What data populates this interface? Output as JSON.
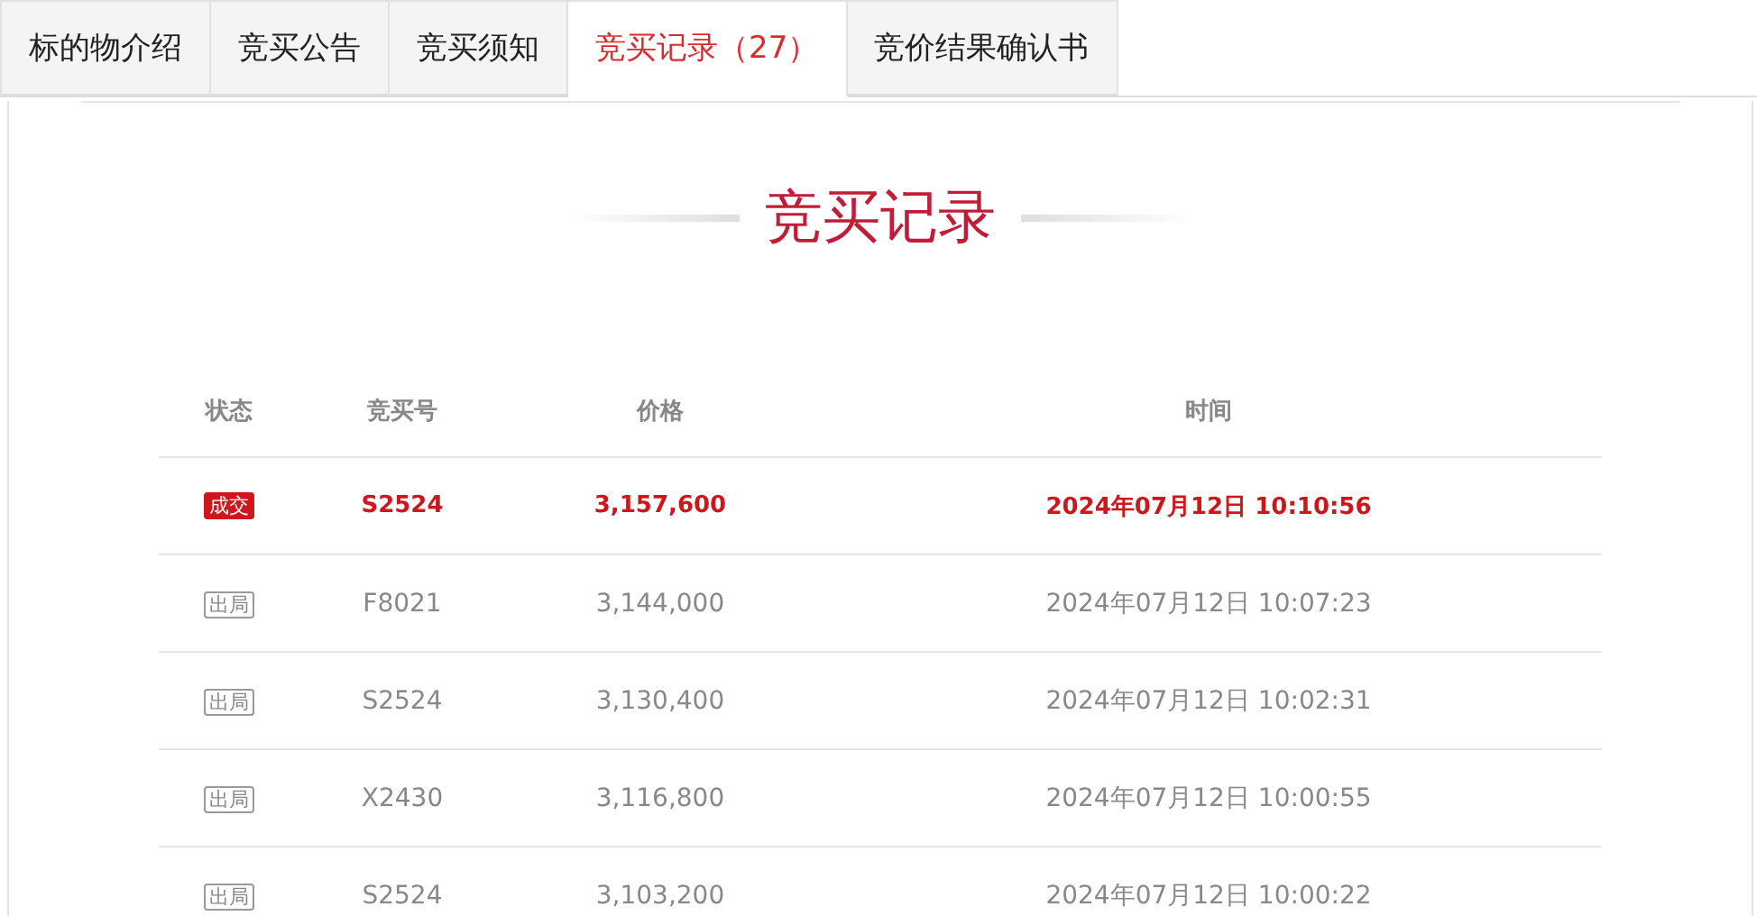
{
  "tabs": [
    {
      "label": "标的物介绍",
      "selected": false
    },
    {
      "label": "竞买公告",
      "selected": false
    },
    {
      "label": "竞买须知",
      "selected": false
    },
    {
      "label": "竞买记录（27）",
      "selected": true
    },
    {
      "label": "竞价结果确认书",
      "selected": false
    }
  ],
  "title": "竞买记录",
  "table": {
    "columns": [
      "状态",
      "竞买号",
      "价格",
      "时间"
    ],
    "rows": [
      {
        "kind": "won",
        "status": "成交",
        "bidder": "S2524",
        "price": "3,157,600",
        "time": "2024年07月12日 10:10:56"
      },
      {
        "kind": "out",
        "status": "出局",
        "bidder": "F8021",
        "price": "3,144,000",
        "time": "2024年07月12日 10:07:23"
      },
      {
        "kind": "out",
        "status": "出局",
        "bidder": "S2524",
        "price": "3,130,400",
        "time": "2024年07月12日 10:02:31"
      },
      {
        "kind": "out",
        "status": "出局",
        "bidder": "X2430",
        "price": "3,116,800",
        "time": "2024年07月12日 10:00:55"
      },
      {
        "kind": "out",
        "status": "出局",
        "bidder": "S2524",
        "price": "3,103,200",
        "time": "2024年07月12日 10:00:22"
      }
    ]
  }
}
